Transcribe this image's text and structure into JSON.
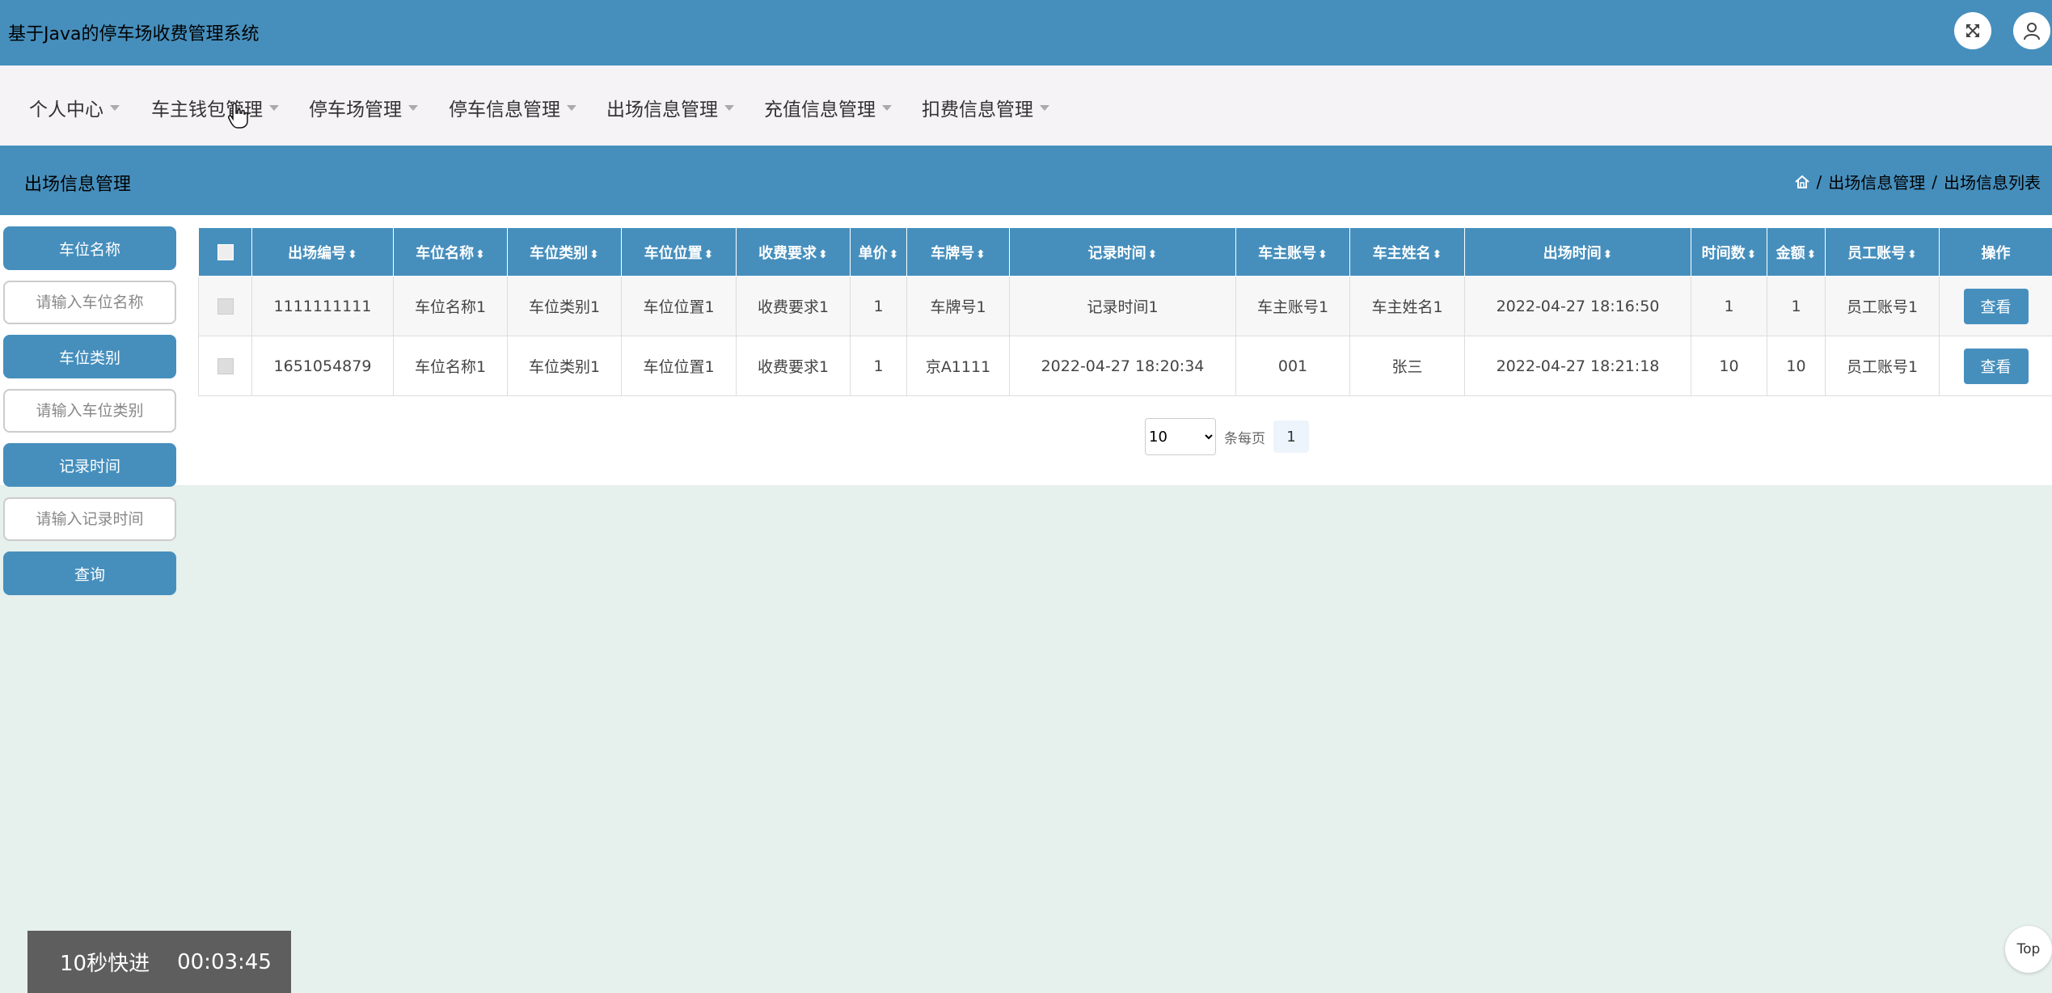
{
  "app": {
    "title": "基于Java的停车场收费管理系统"
  },
  "icons": {
    "fullscreen": "fullscreen-icon",
    "user": "user-icon",
    "home": "home-icon"
  },
  "colors": {
    "primary": "#468fbd",
    "menu_bg": "#f6f3f6",
    "page_bg": "#e6f0ec"
  },
  "menu": [
    {
      "label": "个人中心"
    },
    {
      "label": "车主钱包管理"
    },
    {
      "label": "停车场管理"
    },
    {
      "label": "停车信息管理"
    },
    {
      "label": "出场信息管理"
    },
    {
      "label": "充值信息管理"
    },
    {
      "label": "扣费信息管理"
    }
  ],
  "page": {
    "section_title": "出场信息管理",
    "breadcrumb": {
      "sep": "/",
      "section": "出场信息管理",
      "current": "出场信息列表"
    }
  },
  "filters": {
    "space_name": {
      "label": "车位名称",
      "placeholder": "请输入车位名称"
    },
    "space_type": {
      "label": "车位类别",
      "placeholder": "请输入车位类别"
    },
    "record_time": {
      "label": "记录时间",
      "placeholder": "请输入记录时间"
    },
    "search_label": "查询"
  },
  "table": {
    "sort_glyph": "⬍",
    "headers": [
      "出场编号",
      "车位名称",
      "车位类别",
      "车位位置",
      "收费要求",
      "单价",
      "车牌号",
      "记录时间",
      "车主账号",
      "车主姓名",
      "出场时间",
      "时间数",
      "金额",
      "员工账号",
      "操作"
    ],
    "rows": [
      [
        "1111111111",
        "车位名称1",
        "车位类别1",
        "车位位置1",
        "收费要求1",
        "1",
        "车牌号1",
        "记录时间1",
        "车主账号1",
        "车主姓名1",
        "2022-04-27 18:16:50",
        "1",
        "1",
        "员工账号1"
      ],
      [
        "1651054879",
        "车位名称1",
        "车位类别1",
        "车位位置1",
        "收费要求1",
        "1",
        "京A1111",
        "2022-04-27 18:20:34",
        "001",
        "张三",
        "2022-04-27 18:21:18",
        "10",
        "10",
        "员工账号1"
      ]
    ],
    "view_label": "查看"
  },
  "pagination": {
    "page_size": "10",
    "per_page_label": "条每页",
    "current_page": "1"
  },
  "overlay": {
    "fast_forward": "10秒快进",
    "time": "00:03:45"
  },
  "top_button": "Top"
}
